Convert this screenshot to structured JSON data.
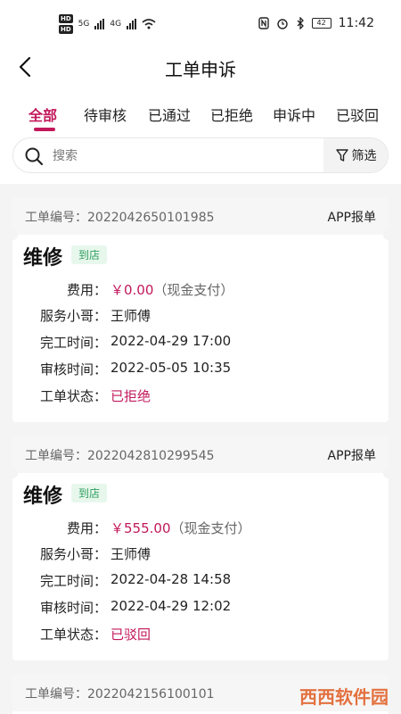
{
  "status_bar": {
    "hd1": "HD",
    "hd2": "HD",
    "net1": "5G",
    "net2": "4G",
    "battery": "42",
    "time": "11:42"
  },
  "header": {
    "title": "工单申诉"
  },
  "tabs": [
    {
      "label": "全部",
      "active": true
    },
    {
      "label": "待审核"
    },
    {
      "label": "已通过"
    },
    {
      "label": "已拒绝"
    },
    {
      "label": "申诉中"
    },
    {
      "label": "已驳回"
    }
  ],
  "search": {
    "placeholder": "搜索",
    "filter_label": "筛选"
  },
  "colors": {
    "accent": "#c2185b",
    "tag_green": "#2e9e5e"
  },
  "orders": [
    {
      "order_label": "工单编号：",
      "order_no": "2022042650101985",
      "source": "APP报单",
      "service": "维修",
      "tag": "到店",
      "fee_label": "费用：",
      "fee": "￥0.00",
      "pay_method": "（现金支付）",
      "worker_label": "服务小哥：",
      "worker": "王师傅",
      "finish_label": "完工时间：",
      "finish_time": "2022-04-29 17:00",
      "review_label": "审核时间：",
      "review_time": "2022-05-05 10:35",
      "status_label": "工单状态：",
      "status": "已拒绝"
    },
    {
      "order_label": "工单编号：",
      "order_no": "2022042810299545",
      "source": "APP报单",
      "service": "维修",
      "tag": "到店",
      "fee_label": "费用：",
      "fee": "￥555.00",
      "pay_method": "（现金支付）",
      "worker_label": "服务小哥：",
      "worker": "王师傅",
      "finish_label": "完工时间：",
      "finish_time": "2022-04-28 14:58",
      "review_label": "审核时间：",
      "review_time": "2022-04-29 12:02",
      "status_label": "工单状态：",
      "status": "已驳回"
    },
    {
      "order_label": "工单编号：",
      "order_no": "2022042156100101"
    }
  ],
  "watermark": "西西软件园"
}
